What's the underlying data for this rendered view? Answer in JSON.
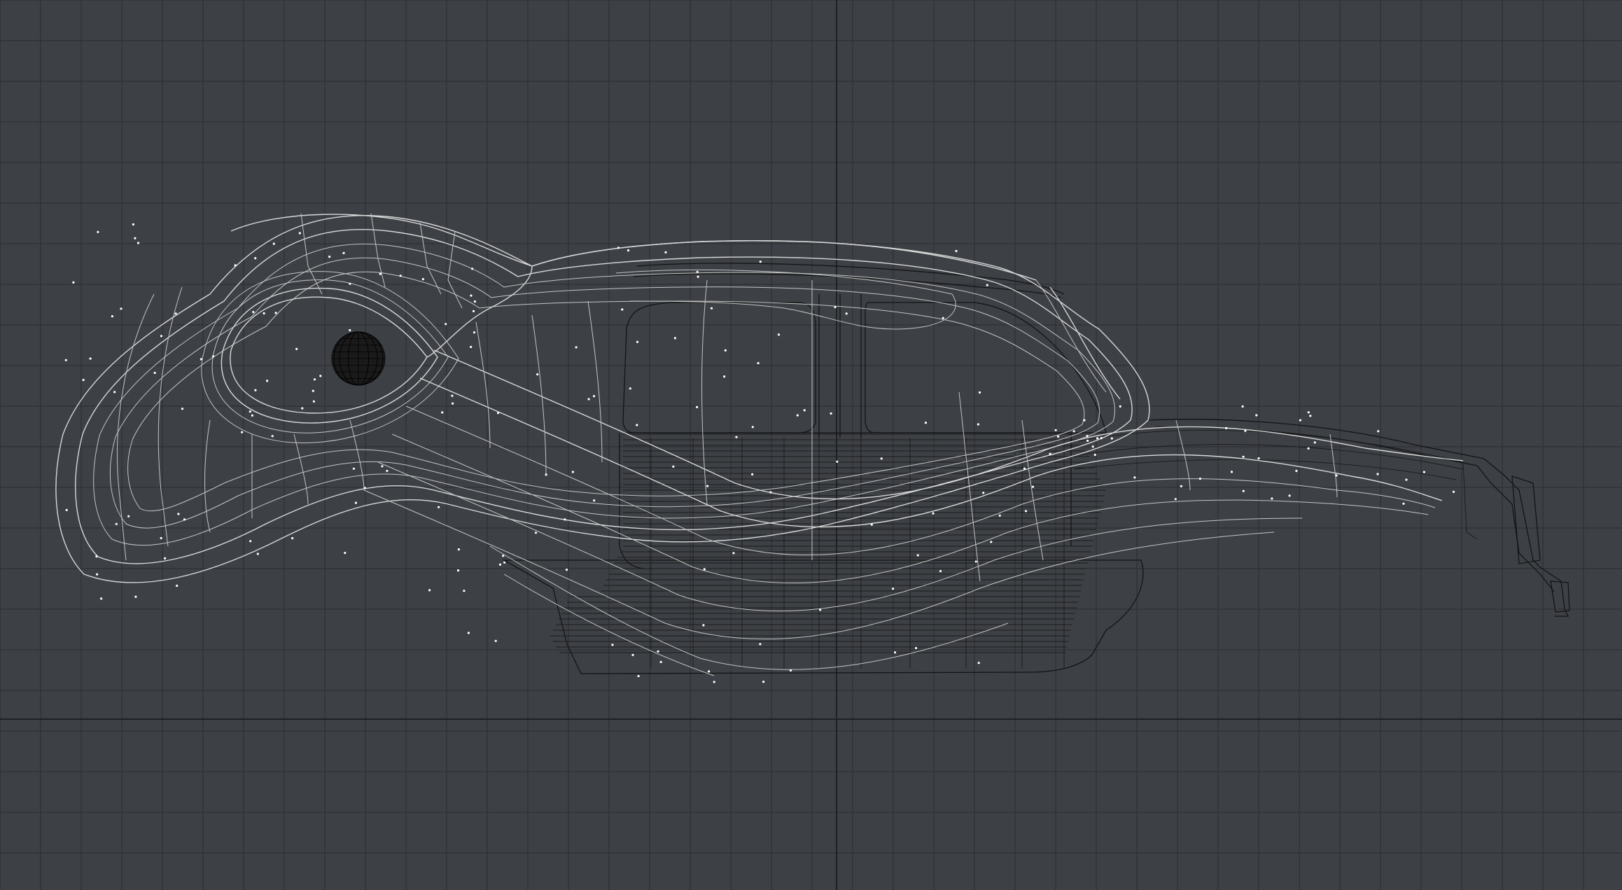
{
  "viewport": {
    "background_color": "#3d4045",
    "grid_line_color": "#2b2d31",
    "axis_line_color": "#1f2124",
    "wire_highlight_color": "#d8d8d8",
    "wire_dark_color": "#141414",
    "grid_visible": true
  }
}
